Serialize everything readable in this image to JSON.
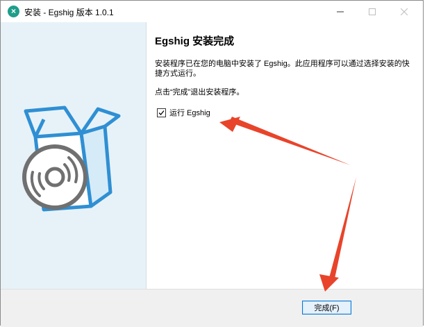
{
  "window": {
    "title": "安装 - Egshig 版本 1.0.1",
    "icon": "app-logo-icon"
  },
  "titlebar_buttons": {
    "minimize_icon": "minimize-icon",
    "maximize_icon": "maximize-icon",
    "close_icon": "close-icon"
  },
  "page": {
    "heading": "Egshig 安装完成",
    "description": "安装程序已在您的电脑中安装了 Egshig。此应用程序可以通过选择安装的快捷方式运行。",
    "hint": "点击“完成”退出安装程序。",
    "run_checkbox": {
      "label": "运行 Egshig",
      "checked": true
    },
    "illustration_icon": "install-box-disc-icon"
  },
  "footer": {
    "finish_label": "完成(F)"
  },
  "annotations": {
    "arrow_color": "#e8442b"
  },
  "colors": {
    "left_pane_bg": "#e7f2f8",
    "accent": "#0078d7",
    "illustration_blue": "#2f8fd3"
  }
}
